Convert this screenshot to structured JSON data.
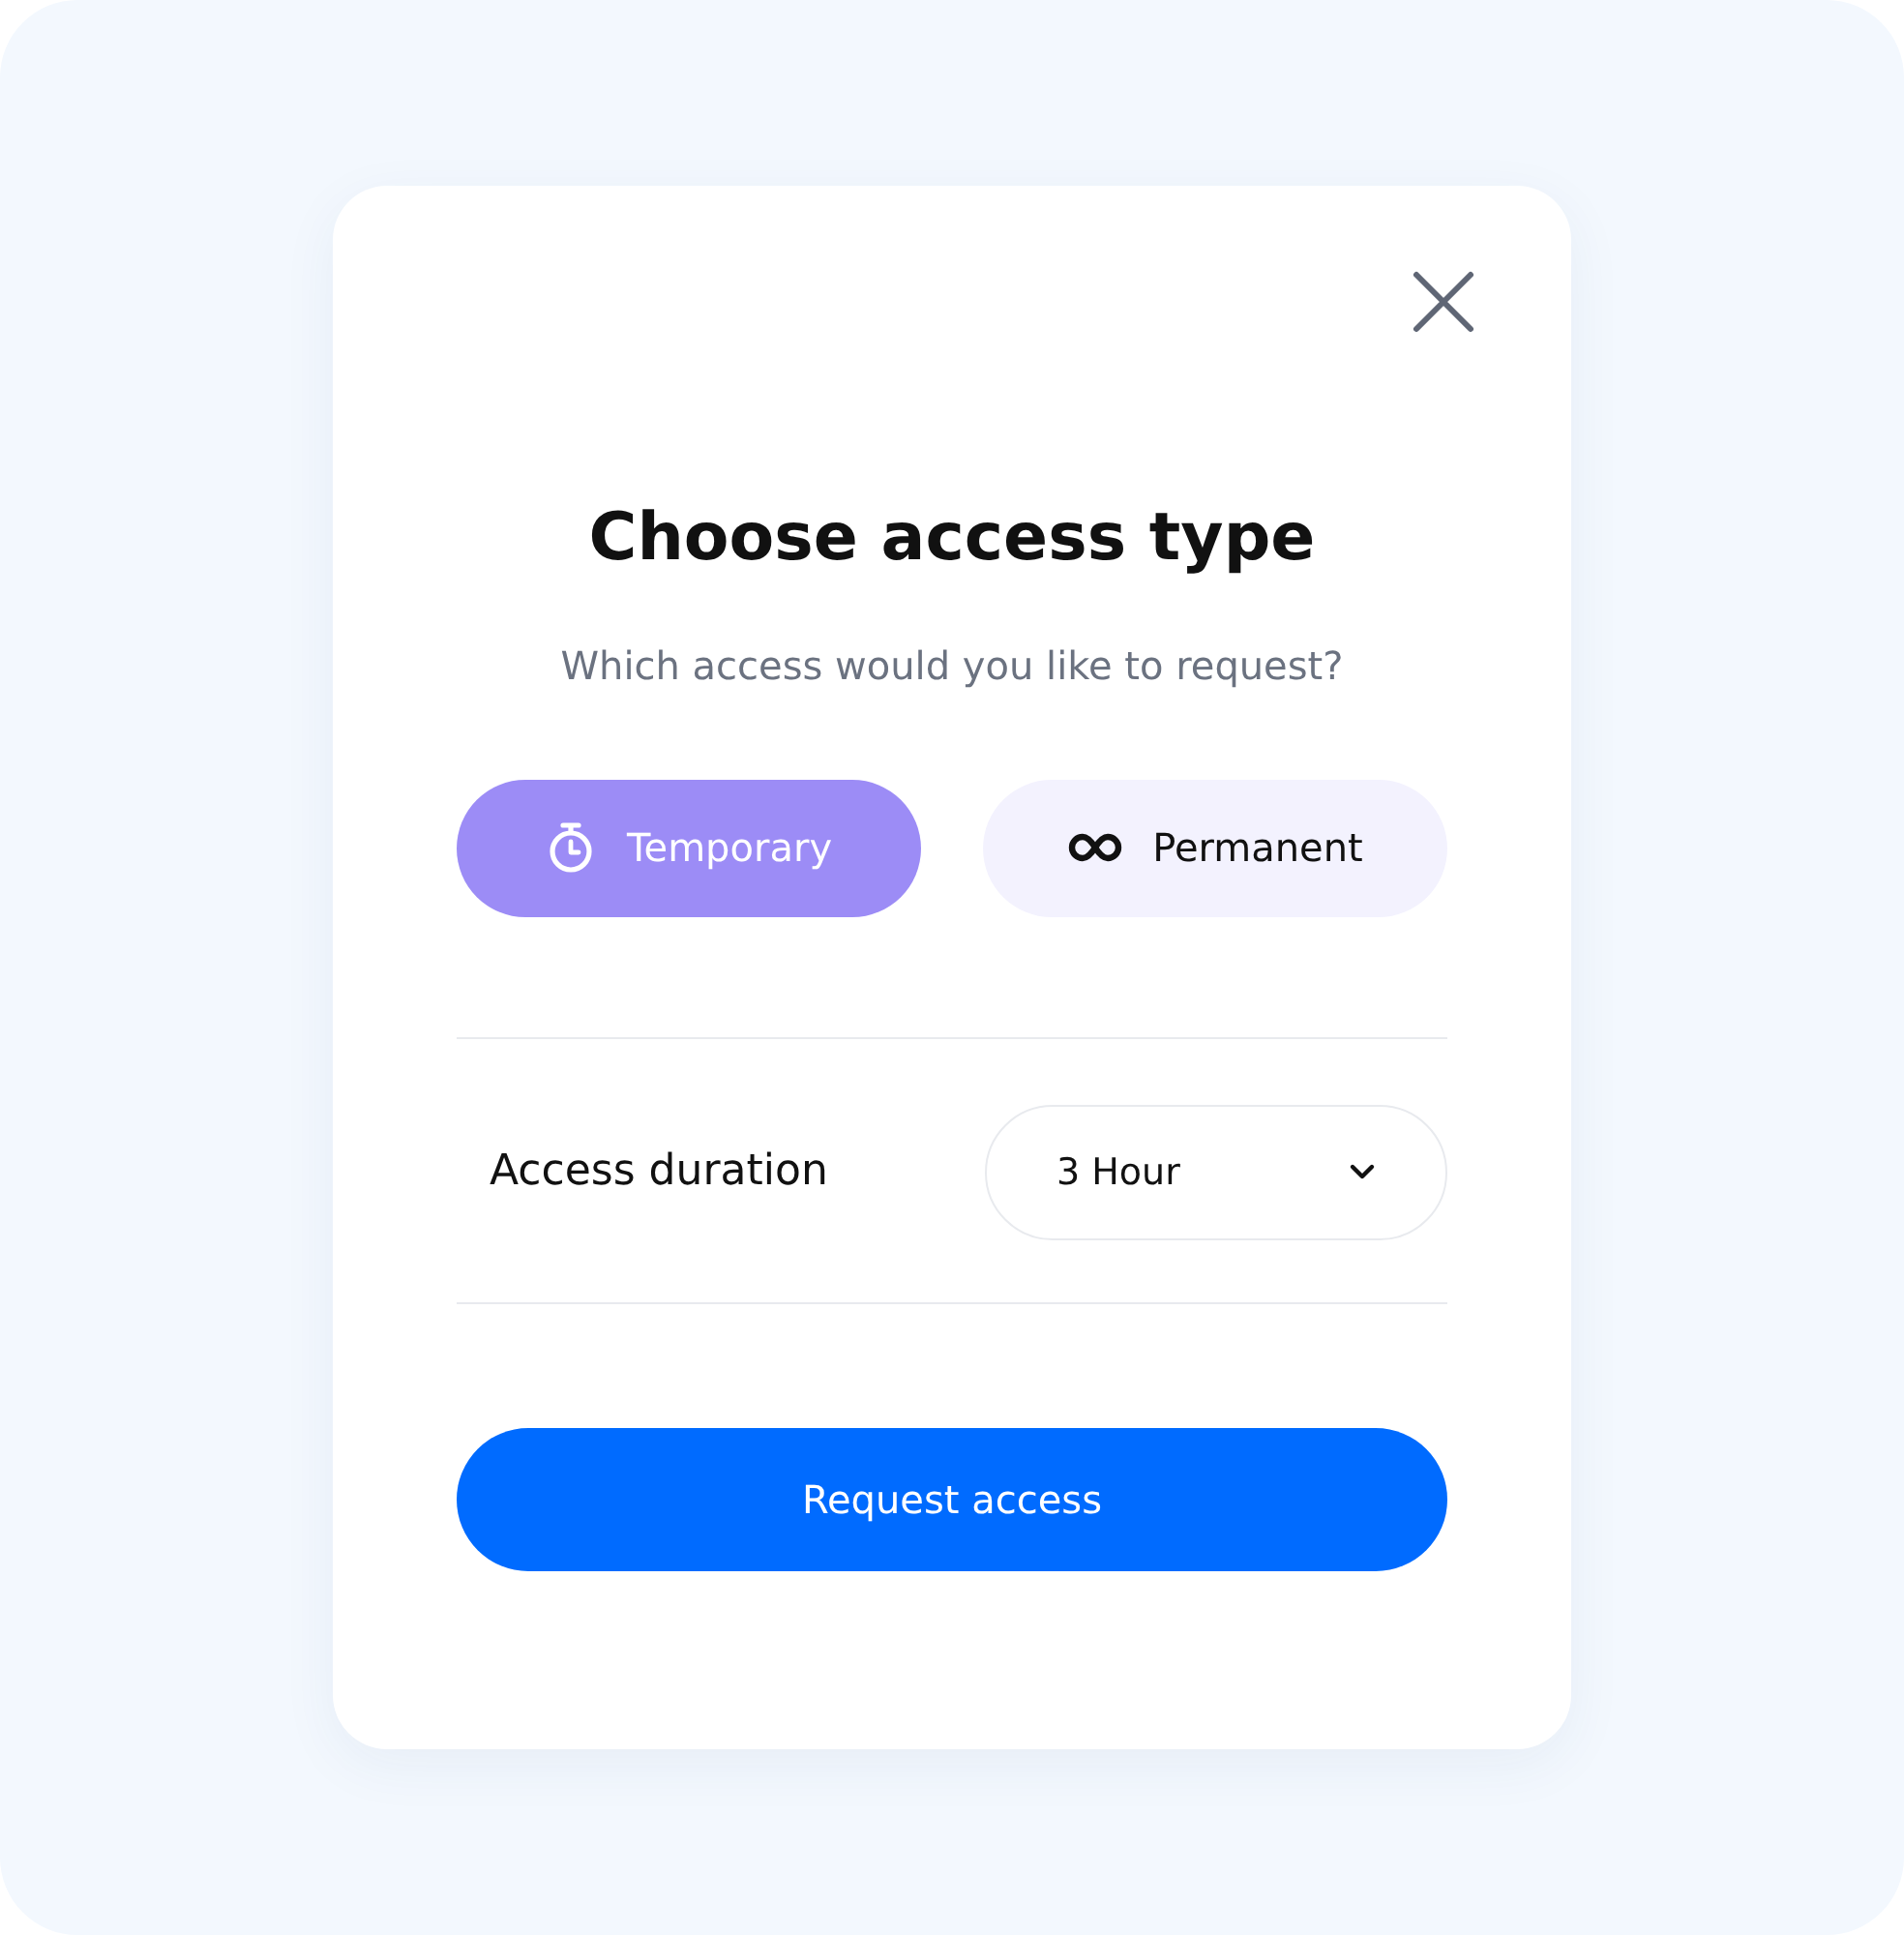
{
  "dialog": {
    "title": "Choose access type",
    "subtitle": "Which access would you like to request?"
  },
  "options": [
    {
      "label": "Temporary",
      "kind": "timer",
      "selected": true
    },
    {
      "label": "Permanent",
      "kind": "infinity",
      "selected": false
    }
  ],
  "duration": {
    "label": "Access duration",
    "value": "3 Hour"
  },
  "submit": {
    "label": "Request access"
  }
}
